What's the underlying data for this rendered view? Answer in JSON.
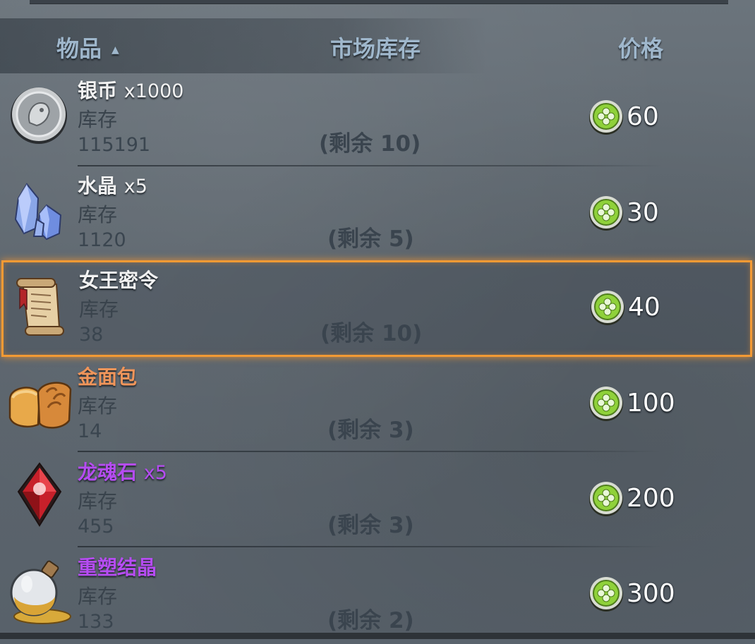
{
  "header": {
    "item_col": "物品",
    "stock_col": "市场库存",
    "price_col": "价格",
    "sort_icon": "sort-ascending-icon"
  },
  "stock_label": "库存",
  "items": [
    {
      "name": "银币",
      "qty": "x1000",
      "stock": "115191",
      "remaining": "(剩余 10)",
      "price": "60",
      "icon": "silver-coin-icon",
      "name_color": "#f2f2f2"
    },
    {
      "name": "水晶",
      "qty": "x5",
      "stock": "1120",
      "remaining": "(剩余 5)",
      "price": "30",
      "icon": "crystal-icon",
      "name_color": "#f2f2f2"
    },
    {
      "name": "女王密令",
      "qty": "",
      "stock": "38",
      "remaining": "(剩余 10)",
      "price": "40",
      "icon": "scroll-icon",
      "name_color": "#f2f2f2",
      "selected": true
    },
    {
      "name": "金面包",
      "qty": "",
      "stock": "14",
      "remaining": "(剩余 3)",
      "price": "100",
      "icon": "bread-icon",
      "name_color": "#f0955a"
    },
    {
      "name": "龙魂石",
      "qty": "x5",
      "stock": "455",
      "remaining": "(剩余 3)",
      "price": "200",
      "icon": "red-gem-icon",
      "name_color": "#b64cf2"
    },
    {
      "name": "重塑结晶",
      "qty": "",
      "stock": "133",
      "remaining": "(剩余 2)",
      "price": "300",
      "icon": "potion-flask-icon",
      "name_color": "#b64cf2"
    }
  ],
  "currency_icon": "clover-coin-icon",
  "colors": {
    "selection": "#f39a34",
    "header_text": "#9fb7cc"
  }
}
